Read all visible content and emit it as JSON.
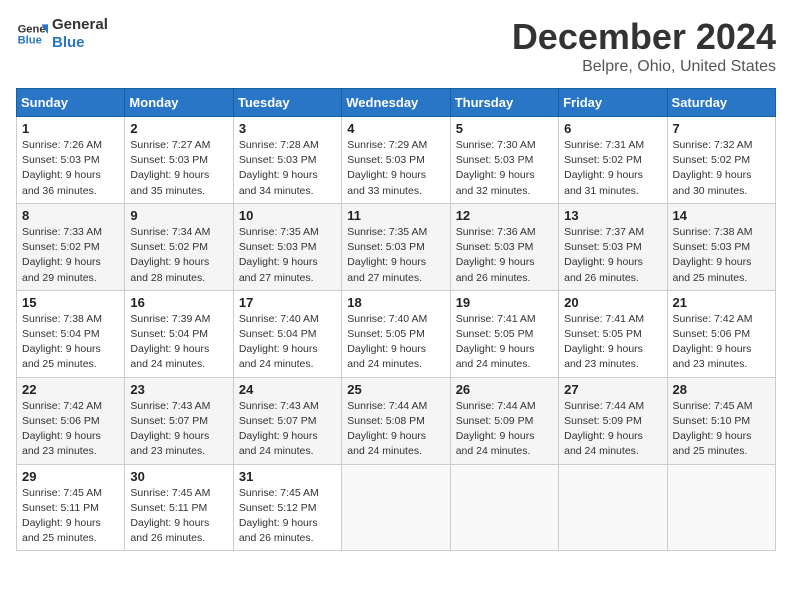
{
  "header": {
    "logo_line1": "General",
    "logo_line2": "Blue",
    "title": "December 2024",
    "subtitle": "Belpre, Ohio, United States"
  },
  "weekdays": [
    "Sunday",
    "Monday",
    "Tuesday",
    "Wednesday",
    "Thursday",
    "Friday",
    "Saturday"
  ],
  "weeks": [
    [
      {
        "day": "1",
        "info": "Sunrise: 7:26 AM\nSunset: 5:03 PM\nDaylight: 9 hours\nand 36 minutes."
      },
      {
        "day": "2",
        "info": "Sunrise: 7:27 AM\nSunset: 5:03 PM\nDaylight: 9 hours\nand 35 minutes."
      },
      {
        "day": "3",
        "info": "Sunrise: 7:28 AM\nSunset: 5:03 PM\nDaylight: 9 hours\nand 34 minutes."
      },
      {
        "day": "4",
        "info": "Sunrise: 7:29 AM\nSunset: 5:03 PM\nDaylight: 9 hours\nand 33 minutes."
      },
      {
        "day": "5",
        "info": "Sunrise: 7:30 AM\nSunset: 5:03 PM\nDaylight: 9 hours\nand 32 minutes."
      },
      {
        "day": "6",
        "info": "Sunrise: 7:31 AM\nSunset: 5:02 PM\nDaylight: 9 hours\nand 31 minutes."
      },
      {
        "day": "7",
        "info": "Sunrise: 7:32 AM\nSunset: 5:02 PM\nDaylight: 9 hours\nand 30 minutes."
      }
    ],
    [
      {
        "day": "8",
        "info": "Sunrise: 7:33 AM\nSunset: 5:02 PM\nDaylight: 9 hours\nand 29 minutes."
      },
      {
        "day": "9",
        "info": "Sunrise: 7:34 AM\nSunset: 5:02 PM\nDaylight: 9 hours\nand 28 minutes."
      },
      {
        "day": "10",
        "info": "Sunrise: 7:35 AM\nSunset: 5:03 PM\nDaylight: 9 hours\nand 27 minutes."
      },
      {
        "day": "11",
        "info": "Sunrise: 7:35 AM\nSunset: 5:03 PM\nDaylight: 9 hours\nand 27 minutes."
      },
      {
        "day": "12",
        "info": "Sunrise: 7:36 AM\nSunset: 5:03 PM\nDaylight: 9 hours\nand 26 minutes."
      },
      {
        "day": "13",
        "info": "Sunrise: 7:37 AM\nSunset: 5:03 PM\nDaylight: 9 hours\nand 26 minutes."
      },
      {
        "day": "14",
        "info": "Sunrise: 7:38 AM\nSunset: 5:03 PM\nDaylight: 9 hours\nand 25 minutes."
      }
    ],
    [
      {
        "day": "15",
        "info": "Sunrise: 7:38 AM\nSunset: 5:04 PM\nDaylight: 9 hours\nand 25 minutes."
      },
      {
        "day": "16",
        "info": "Sunrise: 7:39 AM\nSunset: 5:04 PM\nDaylight: 9 hours\nand 24 minutes."
      },
      {
        "day": "17",
        "info": "Sunrise: 7:40 AM\nSunset: 5:04 PM\nDaylight: 9 hours\nand 24 minutes."
      },
      {
        "day": "18",
        "info": "Sunrise: 7:40 AM\nSunset: 5:05 PM\nDaylight: 9 hours\nand 24 minutes."
      },
      {
        "day": "19",
        "info": "Sunrise: 7:41 AM\nSunset: 5:05 PM\nDaylight: 9 hours\nand 24 minutes."
      },
      {
        "day": "20",
        "info": "Sunrise: 7:41 AM\nSunset: 5:05 PM\nDaylight: 9 hours\nand 23 minutes."
      },
      {
        "day": "21",
        "info": "Sunrise: 7:42 AM\nSunset: 5:06 PM\nDaylight: 9 hours\nand 23 minutes."
      }
    ],
    [
      {
        "day": "22",
        "info": "Sunrise: 7:42 AM\nSunset: 5:06 PM\nDaylight: 9 hours\nand 23 minutes."
      },
      {
        "day": "23",
        "info": "Sunrise: 7:43 AM\nSunset: 5:07 PM\nDaylight: 9 hours\nand 23 minutes."
      },
      {
        "day": "24",
        "info": "Sunrise: 7:43 AM\nSunset: 5:07 PM\nDaylight: 9 hours\nand 24 minutes."
      },
      {
        "day": "25",
        "info": "Sunrise: 7:44 AM\nSunset: 5:08 PM\nDaylight: 9 hours\nand 24 minutes."
      },
      {
        "day": "26",
        "info": "Sunrise: 7:44 AM\nSunset: 5:09 PM\nDaylight: 9 hours\nand 24 minutes."
      },
      {
        "day": "27",
        "info": "Sunrise: 7:44 AM\nSunset: 5:09 PM\nDaylight: 9 hours\nand 24 minutes."
      },
      {
        "day": "28",
        "info": "Sunrise: 7:45 AM\nSunset: 5:10 PM\nDaylight: 9 hours\nand 25 minutes."
      }
    ],
    [
      {
        "day": "29",
        "info": "Sunrise: 7:45 AM\nSunset: 5:11 PM\nDaylight: 9 hours\nand 25 minutes."
      },
      {
        "day": "30",
        "info": "Sunrise: 7:45 AM\nSunset: 5:11 PM\nDaylight: 9 hours\nand 26 minutes."
      },
      {
        "day": "31",
        "info": "Sunrise: 7:45 AM\nSunset: 5:12 PM\nDaylight: 9 hours\nand 26 minutes."
      },
      {
        "day": "",
        "info": ""
      },
      {
        "day": "",
        "info": ""
      },
      {
        "day": "",
        "info": ""
      },
      {
        "day": "",
        "info": ""
      }
    ]
  ]
}
